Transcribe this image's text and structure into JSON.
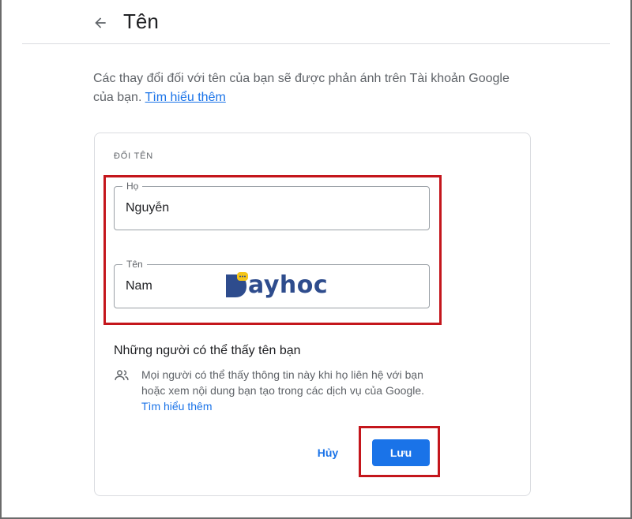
{
  "header": {
    "back_icon": "arrow-back-icon",
    "title": "Tên"
  },
  "intro": {
    "text": "Các thay đổi đối với tên của bạn sẽ được phản ánh trên Tài khoản Google của bạn.",
    "link": "Tìm hiểu thêm"
  },
  "card": {
    "section_label": "ĐỔI TÊN",
    "fields": [
      {
        "label": "Họ",
        "value": "Nguyễn"
      },
      {
        "label": "Tên",
        "value": "Nam"
      }
    ],
    "watermark": "ayhoc",
    "visibility": {
      "title": "Những người có thể thấy tên bạn",
      "icon": "people-icon",
      "text": "Mọi người có thể thấy thông tin này khi họ liên hệ với bạn hoặc xem nội dung bạn tạo trong các dịch vụ của Google.",
      "link": "Tìm hiểu thêm"
    },
    "actions": {
      "cancel": "Hủy",
      "save": "Lưu"
    }
  },
  "colors": {
    "accent": "#1a73e8",
    "highlight": "#c4161c",
    "watermark": "#2e4c8d",
    "watermark_bubble": "#f5c518"
  }
}
